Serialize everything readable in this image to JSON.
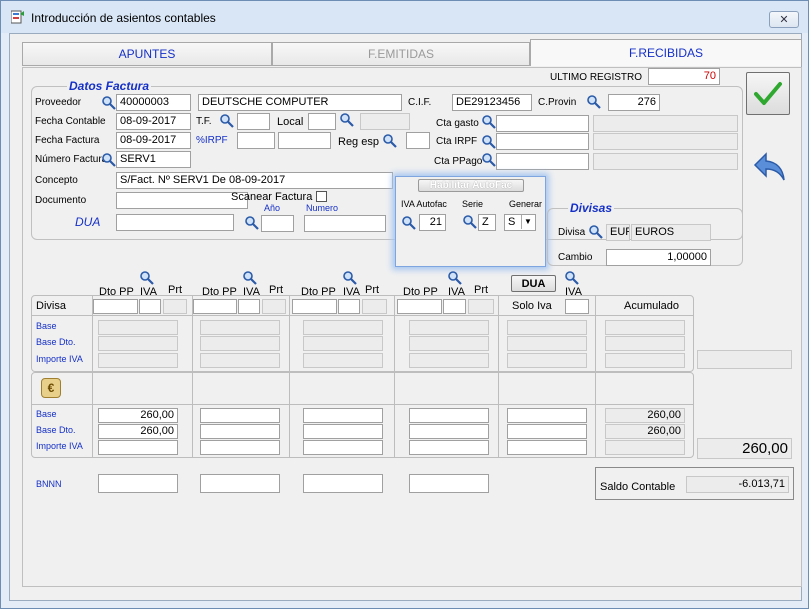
{
  "window": {
    "title": "Introducción de asientos contables",
    "close_label": "✕"
  },
  "tabs": [
    {
      "label": "APUNTES"
    },
    {
      "label": "F.EMITIDAS"
    },
    {
      "label": "F.RECIBIDAS"
    }
  ],
  "header": {
    "ultimo_registro_label": "ULTIMO REGISTRO",
    "ultimo_registro_value": "70"
  },
  "datos": {
    "legend": "Datos Factura",
    "proveedor_label": "Proveedor",
    "proveedor_code": "40000003",
    "proveedor_name": "DEUTSCHE COMPUTER",
    "cif_label": "C.I.F.",
    "cif_value": "DE29123456",
    "cprovin_label": "C.Provin",
    "cprovin_value": "276",
    "fecha_contable_label": "Fecha Contable",
    "fecha_contable_value": "08-09-2017",
    "tf_label": "T.F.",
    "local_label": "Local",
    "cta_gasto_label": "Cta gasto",
    "fecha_factura_label": "Fecha Factura",
    "fecha_factura_value": "08-09-2017",
    "irpf_label": "%IRPF",
    "reg_esp_label": "Reg esp",
    "cta_irpf_label": "Cta  IRPF",
    "numero_factura_label": "Número Factura",
    "numero_factura_value": "SERV1",
    "cta_ppago_label": "Cta PPago",
    "concepto_label": "Concepto",
    "concepto_value": "S/Fact. Nº SERV1 De 08-09-2017",
    "documento_label": "Documento",
    "scanear_label": "Scanear Factura",
    "dua_label": "DUA",
    "anio_label": "Año",
    "numero_label": "Numero"
  },
  "autofac": {
    "button_label": "Habilitar AutoFac",
    "iva_label": "IVA Autofac",
    "iva_value": "21",
    "serie_label": "Serie",
    "serie_value": "Z",
    "generar_label": "Generar",
    "generar_value": "S"
  },
  "divisas": {
    "legend": "Divisas",
    "divisa_label": "Divisa",
    "divisa_code": "EUR",
    "divisa_name": "EUROS",
    "cambio_label": "Cambio",
    "cambio_value": "1,00000"
  },
  "grid": {
    "dto_pp": "Dto PP",
    "iva": "IVA",
    "prt": "Prt",
    "dua_button": "DUA",
    "divisa_label": "Divisa",
    "solo_iva": "Solo Iva",
    "acumulado": "Acumulado",
    "base": "Base",
    "base_dto": "Base Dto.",
    "importe_iva": "Importe IVA",
    "base_value": "260,00",
    "base_dto_value": "260,00",
    "acum_base": "260,00",
    "acum_base_dto": "260,00",
    "total": "260,00",
    "bnnn": "BNNN",
    "saldo_label": "Saldo Contable",
    "saldo_value": "-6.013,71"
  }
}
